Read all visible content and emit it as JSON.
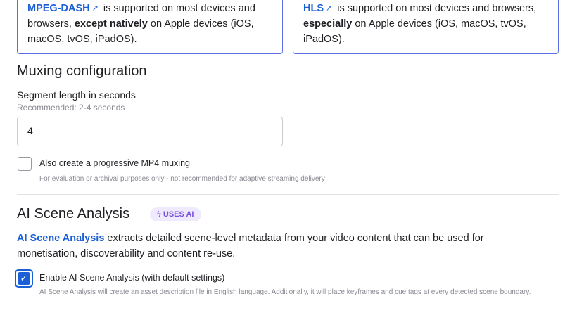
{
  "cards": [
    {
      "link": "MPEG-DASH",
      "t1": " is supported on most devices and browsers, ",
      "bold": "except natively",
      "t2": " on Apple devices (iOS, macOS, tvOS, iPadOS)."
    },
    {
      "link": "HLS",
      "t1": " is supported on most devices and browsers, ",
      "bold": "especially",
      "t2": " on Apple devices (iOS, macOS, tvOS, iPadOS)."
    }
  ],
  "muxing": {
    "title": "Muxing configuration",
    "segment_label": "Segment length in seconds",
    "segment_hint": "Recommended: 2-4 seconds",
    "segment_value": "4",
    "mp4_label": "Also create a progressive MP4 muxing",
    "mp4_checked": false,
    "mp4_hint": "For evaluation or archival purposes only - not recommended for adaptive streaming delivery"
  },
  "ai": {
    "title": "AI Scene Analysis",
    "badge": "USES AI",
    "link": "AI Scene Analysis",
    "desc": " extracts detailed scene-level metadata from your video content that can be used for monetisation, discoverability and content re-use.",
    "enable_label": "Enable AI Scene Analysis (with default settings)",
    "enable_checked": true,
    "enable_hint": "AI Scene Analysis will create an asset description file in English language. Additionally, it will place keyframes and cue tags at every detected scene boundary."
  }
}
